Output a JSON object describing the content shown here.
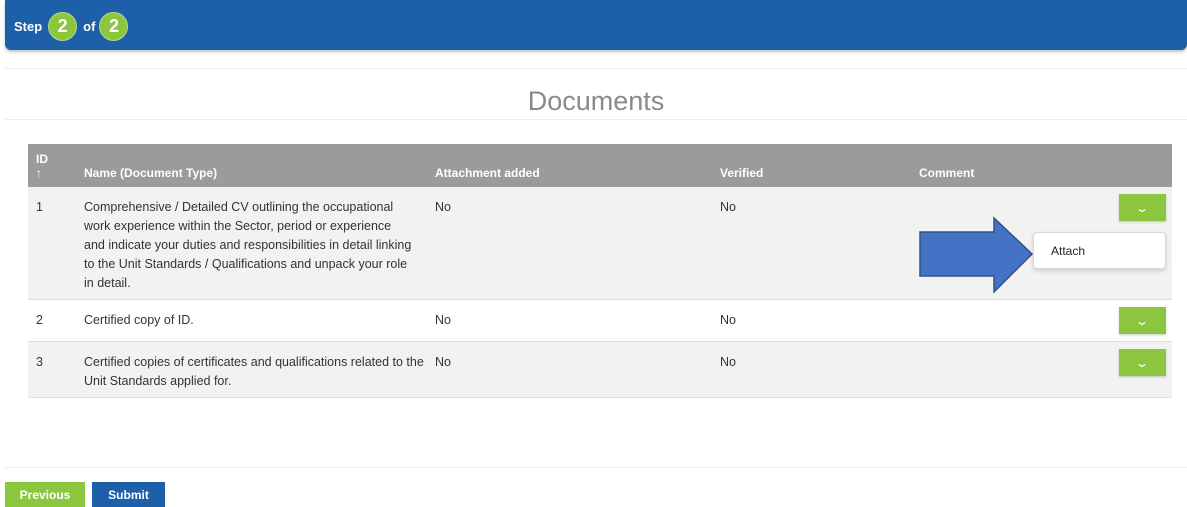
{
  "step": {
    "label": "Step",
    "current": "2",
    "of_label": "of",
    "total": "2"
  },
  "page": {
    "title": "Documents"
  },
  "table": {
    "headers": {
      "id": "ID",
      "sort_indicator": "↑",
      "name": "Name (Document Type)",
      "attachment": "Attachment added",
      "verified": "Verified",
      "comment": "Comment"
    },
    "rows": [
      {
        "id": "1",
        "name": "Comprehensive / Detailed CV outlining the occupational work experience within the Sector, period or experience and indicate your duties and responsibilities in detail linking to the Unit Standards / Qualifications and unpack your role in detail.",
        "attachment": "No",
        "verified": "No",
        "comment": ""
      },
      {
        "id": "2",
        "name": "Certified copy of ID.",
        "attachment": "No",
        "verified": "No",
        "comment": ""
      },
      {
        "id": "3",
        "name": "Certified copies of certificates and qualifications related to the Unit Standards applied for.",
        "attachment": "No",
        "verified": "No",
        "comment": ""
      }
    ],
    "action_icon": "chevron-down-icon"
  },
  "dropdown": {
    "items": [
      "Attach"
    ]
  },
  "buttons": {
    "previous": "Previous",
    "submit": "Submit"
  },
  "colors": {
    "primary_blue": "#1d5fa8",
    "accent_green": "#8cc63f",
    "header_gray": "#9b9b9b",
    "arrow_blue": "#4472c4"
  }
}
